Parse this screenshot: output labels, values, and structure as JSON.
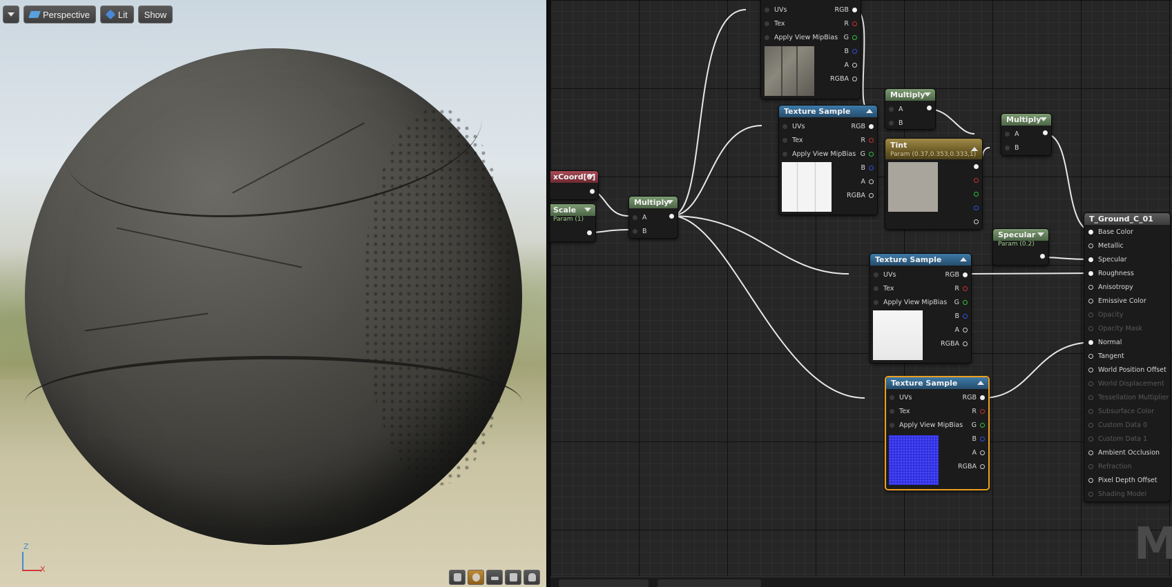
{
  "viewport": {
    "toolbar": {
      "menu_icon": "chevron-down-icon",
      "perspective_label": "Perspective",
      "lit_label": "Lit",
      "show_label": "Show"
    },
    "axis": {
      "z_label": "Z",
      "x_label": "X"
    },
    "bottom_icons": [
      "cylinder-icon",
      "sphere-icon",
      "plane-icon",
      "cube-icon",
      "teapot-icon"
    ]
  },
  "graph": {
    "watermark": "MA",
    "nodes": {
      "texcoord": {
        "title": "xCoord[0]"
      },
      "scale": {
        "title": "Scale",
        "subtitle": "Param (1)"
      },
      "multiply_uv": {
        "title": "Multiply",
        "pin_a": "A",
        "pin_b": "B"
      },
      "tex_top": {
        "pins": [
          "UVs",
          "Tex",
          "Apply View MipBias"
        ],
        "outputs": [
          "RGB",
          "R",
          "G",
          "B",
          "A",
          "RGBA"
        ]
      },
      "tex_base": {
        "title": "Texture Sample",
        "pins": [
          "UVs",
          "Tex",
          "Apply View MipBias"
        ],
        "outputs": [
          "RGB",
          "R",
          "G",
          "B",
          "A",
          "RGBA"
        ]
      },
      "multiply_1": {
        "title": "Multiply",
        "pin_a": "A",
        "pin_b": "B"
      },
      "tint": {
        "title": "Tint",
        "subtitle": "Param (0.37,0.353,0.333,1)"
      },
      "multiply_2": {
        "title": "Multiply",
        "pin_a": "A",
        "pin_b": "B"
      },
      "specular": {
        "title": "Specular",
        "subtitle": "Param (0.2)"
      },
      "tex_rough": {
        "title": "Texture Sample",
        "pins": [
          "UVs",
          "Tex",
          "Apply View MipBias"
        ],
        "outputs": [
          "RGB",
          "R",
          "G",
          "B",
          "A",
          "RGBA"
        ]
      },
      "tex_normal": {
        "title": "Texture Sample",
        "pins": [
          "UVs",
          "Tex",
          "Apply View MipBias"
        ],
        "outputs": [
          "RGB",
          "R",
          "G",
          "B",
          "A",
          "RGBA"
        ]
      },
      "material": {
        "title": "T_Ground_C_01",
        "inputs": [
          {
            "label": "Base Color",
            "enabled": true
          },
          {
            "label": "Metallic",
            "enabled": true
          },
          {
            "label": "Specular",
            "enabled": true
          },
          {
            "label": "Roughness",
            "enabled": true
          },
          {
            "label": "Anisotropy",
            "enabled": true
          },
          {
            "label": "Emissive Color",
            "enabled": true
          },
          {
            "label": "Opacity",
            "enabled": false
          },
          {
            "label": "Opacity Mask",
            "enabled": false
          },
          {
            "label": "Normal",
            "enabled": true
          },
          {
            "label": "Tangent",
            "enabled": true
          },
          {
            "label": "World Position Offset",
            "enabled": true
          },
          {
            "label": "World Displacement",
            "enabled": false
          },
          {
            "label": "Tessellation Multiplier",
            "enabled": false
          },
          {
            "label": "Subsurface Color",
            "enabled": false
          },
          {
            "label": "Custom Data 0",
            "enabled": false
          },
          {
            "label": "Custom Data 1",
            "enabled": false
          },
          {
            "label": "Ambient Occlusion",
            "enabled": true
          },
          {
            "label": "Refraction",
            "enabled": false
          },
          {
            "label": "Pixel Depth Offset",
            "enabled": true
          },
          {
            "label": "Shading Model",
            "enabled": false
          }
        ]
      }
    }
  }
}
